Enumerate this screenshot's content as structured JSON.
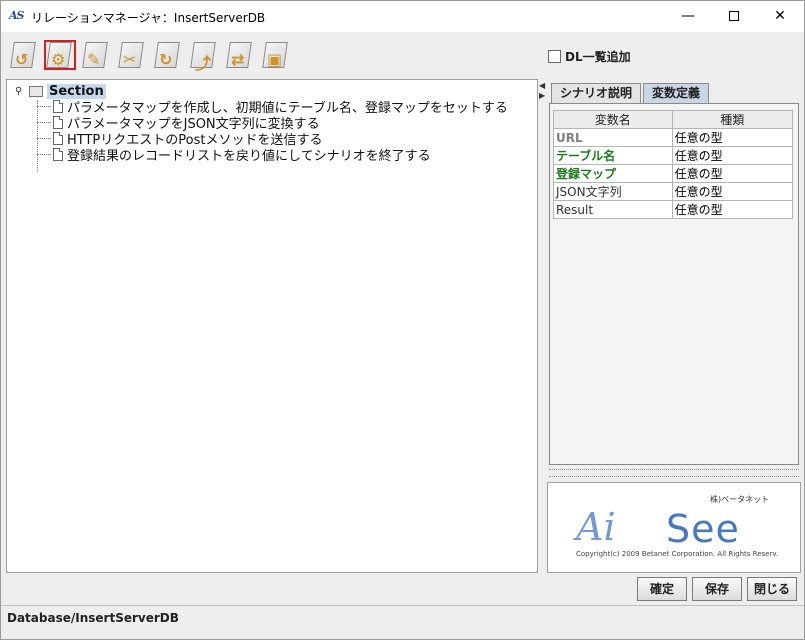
{
  "window": {
    "app_icon_text": "AS",
    "title": "リレーションマネージャ：InsertServerDB",
    "minimize_glyph": "—",
    "close_glyph": "✕"
  },
  "toolbar": {
    "buttons": [
      {
        "icon": "undo-icon",
        "glyph": "↺"
      },
      {
        "icon": "settings-icon",
        "glyph": "⚙"
      },
      {
        "icon": "edit-icon",
        "glyph": "✎"
      },
      {
        "icon": "cut-icon",
        "glyph": "✂"
      },
      {
        "icon": "copy-icon",
        "glyph": "↻"
      },
      {
        "icon": "paste-icon",
        "glyph": "⤴"
      },
      {
        "icon": "move-icon",
        "glyph": "⇄"
      },
      {
        "icon": "delete-icon",
        "glyph": "▣"
      }
    ],
    "active_index": 1
  },
  "dl_option": {
    "label": "DL一覧追加",
    "checked": false
  },
  "tree": {
    "root_label": "Section",
    "items": [
      "パラメータマップを作成し、初期値にテーブル名、登録マップをセットする",
      "パラメータマップをJSON文字列に変換する",
      "HTTPリクエストのPostメソッドを送信する",
      "登録結果のレコードリストを戻り値にしてシナリオを終了する"
    ]
  },
  "tabs": {
    "scenario": "シナリオ説明",
    "variables": "変数定義",
    "active": "variables"
  },
  "var_table": {
    "headers": [
      "変数名",
      "種類"
    ],
    "rows": [
      {
        "name": "URL",
        "type": "任意の型",
        "color": "#808080",
        "bold": true
      },
      {
        "name": "テーブル名",
        "type": "任意の型",
        "color": "#1a7a1a",
        "bold": true
      },
      {
        "name": "登録マップ",
        "type": "任意の型",
        "color": "#1a7a1a",
        "bold": true
      },
      {
        "name": "JSON文字列",
        "type": "任意の型",
        "color": "#333333",
        "bold": false
      },
      {
        "name": "Result",
        "type": "任意の型",
        "color": "#333333",
        "bold": false
      }
    ]
  },
  "logo": {
    "company": "株)ベータネット",
    "mark_ai": "Ai",
    "mark_see": "See",
    "copyright": "Copyright(c) 2009 Betanet Corporation. All Rights Reserv."
  },
  "buttons": {
    "ok": "確定",
    "save": "保存",
    "close": "閉じる"
  },
  "status": {
    "path": "Database/InsertServerDB"
  }
}
